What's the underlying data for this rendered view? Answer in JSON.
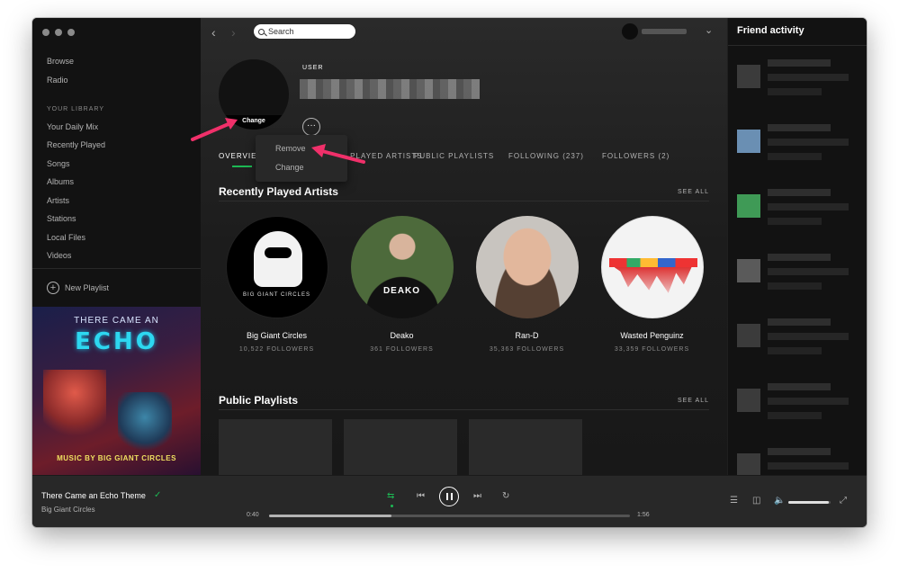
{
  "sidebar": {
    "nav": [
      {
        "label": "Browse"
      },
      {
        "label": "Radio"
      }
    ],
    "library_heading": "YOUR LIBRARY",
    "library": [
      {
        "label": "Your Daily Mix"
      },
      {
        "label": "Recently Played"
      },
      {
        "label": "Songs"
      },
      {
        "label": "Albums"
      },
      {
        "label": "Artists"
      },
      {
        "label": "Stations"
      },
      {
        "label": "Local Files"
      },
      {
        "label": "Videos"
      }
    ],
    "new_playlist": "New Playlist",
    "cover": {
      "top": "THERE CAME AN",
      "title": "ECHO",
      "bottom": "MUSIC BY BIG GIANT CIRCLES"
    }
  },
  "topbar": {
    "search_placeholder": "Search"
  },
  "profile": {
    "type_label": "USER",
    "change_label": "Change",
    "more_label": "···"
  },
  "context_menu": {
    "items": [
      {
        "label": "Remove"
      },
      {
        "label": "Change"
      }
    ]
  },
  "tabs": [
    {
      "label": "OVERVIEW"
    },
    {
      "label": "RECENTLY PLAYED ARTISTS"
    },
    {
      "label": "PUBLIC PLAYLISTS"
    },
    {
      "label": "FOLLOWING (237)"
    },
    {
      "label": "FOLLOWERS (2)"
    }
  ],
  "recently_played": {
    "title": "Recently Played Artists",
    "see_all": "SEE ALL",
    "artists": [
      {
        "name": "Big Giant Circles",
        "followers": "10,522 FOLLOWERS",
        "art_text": "BIG GIANT CIRCLES"
      },
      {
        "name": "Deako",
        "followers": "361 FOLLOWERS",
        "art_text": "DEAKO"
      },
      {
        "name": "Ran-D",
        "followers": "35,363 FOLLOWERS"
      },
      {
        "name": "Wasted Penguinz",
        "followers": "33,359 FOLLOWERS"
      }
    ]
  },
  "public_playlists": {
    "title": "Public Playlists",
    "see_all": "SEE ALL"
  },
  "friends": {
    "title": "Friend activity"
  },
  "player": {
    "track": "There Came an Echo Theme",
    "artist": "Big Giant Circles",
    "elapsed": "0:40",
    "duration": "1:56",
    "progress": 0.34,
    "volume": 0.95
  },
  "colors": {
    "accent": "#1db954",
    "annotation_arrow": "#f0306a"
  }
}
